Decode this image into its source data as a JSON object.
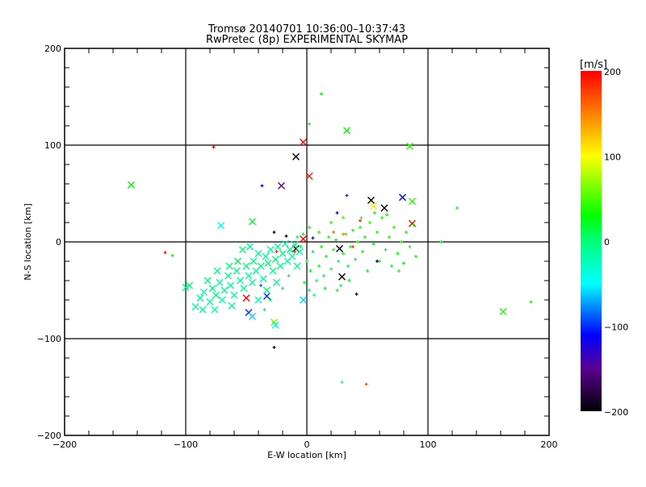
{
  "chart_data": {
    "type": "scatter",
    "title": "Tromsø 20140701 10:36:00–10:37:43",
    "subtitle": "RwPretec (8p) EXPERIMENTAL SKYMAP",
    "xlabel": "E-W location [km]",
    "ylabel": "N-S location [km]",
    "xlim": [
      -200,
      200
    ],
    "ylim": [
      -200,
      200
    ],
    "xticks": [
      -200,
      -100,
      0,
      100,
      200
    ],
    "yticks": [
      -200,
      -100,
      0,
      100,
      200
    ],
    "xtick_labels": [
      "−200",
      "−100",
      "0",
      "100",
      "200"
    ],
    "ytick_labels": [
      "−200",
      "−100",
      "0",
      "100",
      "200"
    ],
    "grid": true,
    "colorbar": {
      "label": "[m/s]",
      "range": [
        -200,
        200
      ],
      "ticks": [
        200,
        100,
        0,
        -100,
        -200
      ],
      "tick_labels": [
        "200",
        "100",
        "0",
        "−100",
        "−200"
      ],
      "colormap_stops": [
        {
          "v": -200,
          "color": "#000000"
        },
        {
          "v": -150,
          "color": "#5a0090"
        },
        {
          "v": -110,
          "color": "#0000ff"
        },
        {
          "v": -50,
          "color": "#00ffff"
        },
        {
          "v": 0,
          "color": "#00ff78"
        },
        {
          "v": 30,
          "color": "#00ff00"
        },
        {
          "v": 100,
          "color": "#ffff00"
        },
        {
          "v": 150,
          "color": "#ff8000"
        },
        {
          "v": 200,
          "color": "#ff0000"
        }
      ]
    },
    "point_fields": [
      "x_km",
      "y_km",
      "velocity_ms",
      "large_marker"
    ],
    "points": [
      [
        -145,
        59,
        30,
        1
      ],
      [
        -3,
        103,
        200,
        1
      ],
      [
        -9,
        88,
        -200,
        1
      ],
      [
        2,
        68,
        190,
        1
      ],
      [
        33,
        115,
        30,
        1
      ],
      [
        85,
        99,
        40,
        1
      ],
      [
        12,
        153,
        30,
        0
      ],
      [
        2,
        122,
        30,
        0
      ],
      [
        -77,
        98,
        200,
        0
      ],
      [
        -21,
        58,
        -150,
        1
      ],
      [
        -37,
        58,
        -110,
        0
      ],
      [
        53,
        43,
        -200,
        1
      ],
      [
        64,
        35,
        -200,
        1
      ],
      [
        79,
        46,
        -110,
        1
      ],
      [
        87,
        42,
        40,
        1
      ],
      [
        87,
        19,
        200,
        1
      ],
      [
        124,
        35,
        20,
        0
      ],
      [
        162,
        -72,
        40,
        1
      ],
      [
        185,
        -62,
        40,
        0
      ],
      [
        111,
        0,
        20,
        0
      ],
      [
        -50,
        -58,
        200,
        1
      ],
      [
        -33,
        -56,
        -100,
        1
      ],
      [
        -48,
        -73,
        -100,
        1
      ],
      [
        -45,
        -77,
        -60,
        1
      ],
      [
        -27,
        -83,
        60,
        1
      ],
      [
        -26,
        -86,
        -40,
        1
      ],
      [
        -27,
        -109,
        -200,
        0
      ],
      [
        29,
        -145,
        -40,
        0
      ],
      [
        49,
        -147,
        170,
        0
      ],
      [
        29,
        -36,
        -200,
        1
      ],
      [
        41,
        -54,
        -200,
        0
      ],
      [
        27,
        -7,
        -200,
        1
      ],
      [
        -9,
        -7,
        -200,
        1
      ],
      [
        -117,
        -11,
        190,
        0
      ],
      [
        -111,
        -14,
        30,
        0
      ],
      [
        -71,
        17,
        -40,
        1
      ],
      [
        -45,
        21,
        20,
        1
      ],
      [
        55,
        37,
        110,
        1
      ],
      [
        -92,
        -67,
        -15,
        1
      ],
      [
        -88,
        -58,
        -10,
        1
      ],
      [
        -85,
        -52,
        -20,
        1
      ],
      [
        -80,
        -62,
        -15,
        1
      ],
      [
        -78,
        -48,
        -10,
        1
      ],
      [
        -75,
        -55,
        -5,
        1
      ],
      [
        -72,
        -42,
        -15,
        1
      ],
      [
        -70,
        -60,
        -20,
        1
      ],
      [
        -68,
        -50,
        -10,
        1
      ],
      [
        -65,
        -35,
        -5,
        1
      ],
      [
        -63,
        -45,
        -15,
        1
      ],
      [
        -60,
        -55,
        -10,
        1
      ],
      [
        -58,
        -30,
        -5,
        1
      ],
      [
        -55,
        -40,
        -15,
        1
      ],
      [
        -52,
        -48,
        -10,
        1
      ],
      [
        -50,
        -25,
        -5,
        1
      ],
      [
        -48,
        -35,
        -15,
        1
      ],
      [
        -45,
        -42,
        -10,
        1
      ],
      [
        -44,
        -20,
        -5,
        1
      ],
      [
        -42,
        -30,
        -15,
        1
      ],
      [
        -40,
        -12,
        -10,
        1
      ],
      [
        -38,
        -25,
        -5,
        1
      ],
      [
        -36,
        -38,
        -15,
        1
      ],
      [
        -34,
        -15,
        -10,
        1
      ],
      [
        -32,
        -22,
        -5,
        1
      ],
      [
        -30,
        -8,
        -15,
        1
      ],
      [
        -28,
        -30,
        -10,
        1
      ],
      [
        -26,
        -18,
        -5,
        1
      ],
      [
        -24,
        -5,
        -15,
        1
      ],
      [
        -22,
        -25,
        -10,
        1
      ],
      [
        -20,
        -12,
        -5,
        1
      ],
      [
        -18,
        -2,
        -15,
        1
      ],
      [
        -16,
        -20,
        -10,
        1
      ],
      [
        -14,
        -8,
        -5,
        1
      ],
      [
        -12,
        -15,
        -15,
        1
      ],
      [
        -10,
        -3,
        -10,
        1
      ],
      [
        -8,
        -25,
        -5,
        1
      ],
      [
        -6,
        -10,
        -15,
        1
      ],
      [
        -97,
        -45,
        -5,
        1
      ],
      [
        -100,
        -47,
        -5,
        1
      ],
      [
        -86,
        -70,
        -10,
        1
      ],
      [
        -76,
        -70,
        -20,
        1
      ],
      [
        -62,
        -66,
        -15,
        1
      ],
      [
        -57,
        -20,
        10,
        1
      ],
      [
        -64,
        -25,
        -5,
        1
      ],
      [
        -74,
        -30,
        -10,
        1
      ],
      [
        -82,
        -40,
        -5,
        1
      ],
      [
        -53,
        -8,
        0,
        1
      ],
      [
        -47,
        -5,
        -10,
        1
      ],
      [
        -40,
        -60,
        -15,
        1
      ],
      [
        -33,
        -50,
        -5,
        1
      ],
      [
        -25,
        -42,
        -10,
        1
      ],
      [
        -3,
        -60,
        -60,
        1
      ],
      [
        -3,
        3,
        200,
        1
      ],
      [
        0,
        -20,
        10,
        0
      ],
      [
        3,
        -30,
        20,
        0
      ],
      [
        5,
        -10,
        15,
        0
      ],
      [
        8,
        -40,
        5,
        0
      ],
      [
        10,
        -25,
        25,
        0
      ],
      [
        12,
        -5,
        30,
        0
      ],
      [
        14,
        -35,
        10,
        0
      ],
      [
        16,
        -15,
        20,
        0
      ],
      [
        18,
        5,
        35,
        0
      ],
      [
        20,
        -28,
        15,
        0
      ],
      [
        22,
        -8,
        25,
        0
      ],
      [
        24,
        2,
        30,
        0
      ],
      [
        26,
        -20,
        10,
        0
      ],
      [
        28,
        -45,
        5,
        0
      ],
      [
        30,
        -12,
        20,
        0
      ],
      [
        32,
        8,
        35,
        0
      ],
      [
        34,
        -25,
        15,
        0
      ],
      [
        36,
        -5,
        25,
        0
      ],
      [
        38,
        12,
        30,
        0
      ],
      [
        40,
        -18,
        10,
        0
      ],
      [
        42,
        0,
        40,
        0
      ],
      [
        44,
        15,
        35,
        0
      ],
      [
        46,
        -10,
        20,
        0
      ],
      [
        48,
        5,
        30,
        0
      ],
      [
        50,
        -30,
        25,
        0
      ],
      [
        52,
        20,
        40,
        0
      ],
      [
        55,
        -2,
        30,
        0
      ],
      [
        58,
        10,
        35,
        0
      ],
      [
        60,
        -20,
        25,
        0
      ],
      [
        62,
        25,
        40,
        0
      ],
      [
        65,
        -8,
        30,
        0
      ],
      [
        68,
        5,
        35,
        0
      ],
      [
        70,
        -25,
        20,
        0
      ],
      [
        72,
        15,
        40,
        0
      ],
      [
        75,
        -12,
        30,
        0
      ],
      [
        78,
        0,
        35,
        0
      ],
      [
        80,
        -22,
        25,
        0
      ],
      [
        82,
        10,
        30,
        0
      ],
      [
        85,
        -5,
        40,
        0
      ],
      [
        88,
        18,
        35,
        0
      ],
      [
        90,
        -15,
        30,
        0
      ],
      [
        76,
        -30,
        25,
        0
      ],
      [
        66,
        28,
        30,
        0
      ],
      [
        56,
        30,
        20,
        0
      ],
      [
        2,
        -50,
        10,
        0
      ],
      [
        -2,
        -42,
        15,
        0
      ],
      [
        6,
        -55,
        5,
        0
      ],
      [
        15,
        -48,
        20,
        0
      ],
      [
        -5,
        -5,
        20,
        0
      ],
      [
        -3,
        8,
        30,
        0
      ],
      [
        2,
        15,
        35,
        0
      ],
      [
        -8,
        5,
        10,
        0
      ],
      [
        25,
        -50,
        15,
        0
      ],
      [
        35,
        -40,
        20,
        0
      ],
      [
        45,
        25,
        45,
        0
      ],
      [
        20,
        20,
        40,
        0
      ],
      [
        30,
        25,
        45,
        0
      ],
      [
        10,
        10,
        35,
        0
      ],
      [
        -15,
        -35,
        15,
        0
      ],
      [
        -20,
        -48,
        10,
        0
      ],
      [
        -30,
        -60,
        20,
        0
      ],
      [
        -35,
        -70,
        15,
        0
      ],
      [
        22,
        10,
        160,
        0
      ],
      [
        30,
        8,
        150,
        0
      ],
      [
        38,
        -5,
        180,
        0
      ],
      [
        44,
        22,
        190,
        0
      ],
      [
        25,
        30,
        -110,
        0
      ],
      [
        33,
        48,
        -100,
        0
      ],
      [
        -10,
        -10,
        180,
        0
      ],
      [
        -25,
        -10,
        190,
        0
      ],
      [
        -27,
        10,
        -200,
        0
      ],
      [
        -38,
        -45,
        -90,
        0
      ],
      [
        5,
        4,
        -120,
        0
      ],
      [
        -17,
        6,
        -200,
        0
      ],
      [
        58,
        -20,
        -200,
        0
      ]
    ]
  }
}
